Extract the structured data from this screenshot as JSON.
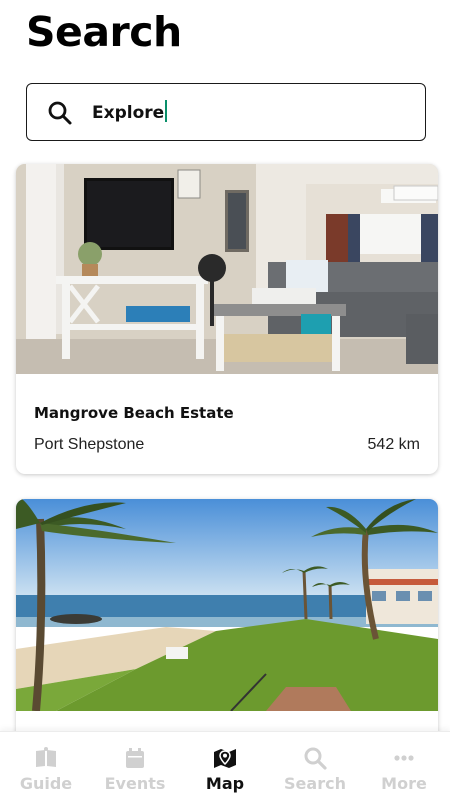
{
  "page": {
    "title": "Search"
  },
  "search": {
    "value": "Explore"
  },
  "results": [
    {
      "name": "Mangrove Beach Estate",
      "location": "Port Shepstone",
      "distance": "542 km",
      "image": "living-room-photo"
    },
    {
      "name": "",
      "location": "",
      "distance": "",
      "image": "beach-palm-photo"
    }
  ],
  "tabbar": {
    "active": "Map",
    "tabs": [
      {
        "label": "Guide",
        "icon": "book-icon"
      },
      {
        "label": "Events",
        "icon": "calendar-icon"
      },
      {
        "label": "Map",
        "icon": "map-pin-icon"
      },
      {
        "label": "Search",
        "icon": "search-icon"
      },
      {
        "label": "More",
        "icon": "more-icon"
      }
    ]
  },
  "colors": {
    "active_tab": "#111111",
    "inactive_tab": "#d0d0d0",
    "caret": "#0a8f6a"
  }
}
